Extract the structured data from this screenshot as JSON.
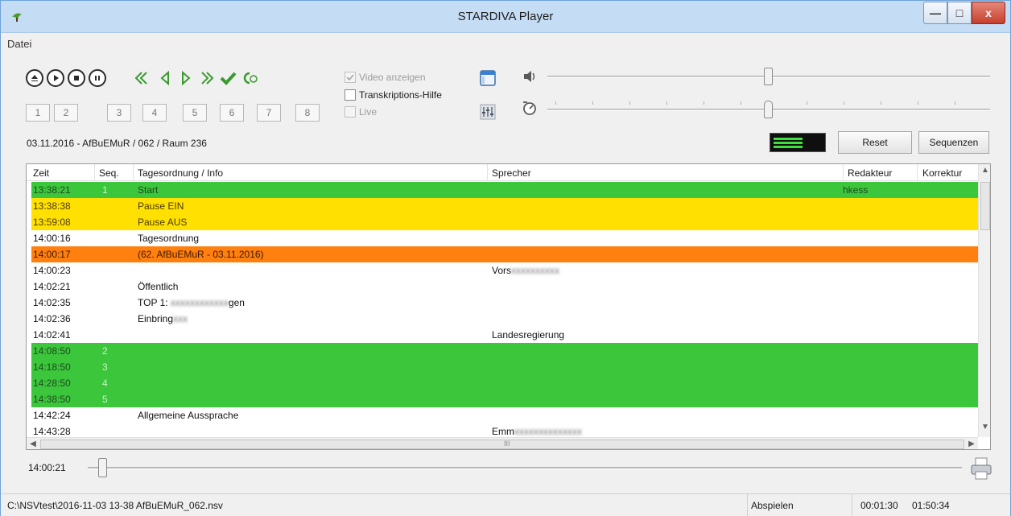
{
  "window": {
    "title": "STARDIVA Player",
    "minimize": "—",
    "maximize": "□",
    "close": "x"
  },
  "menu": {
    "file": "Datei"
  },
  "transport": {
    "eject_icon": "eject-icon",
    "play_icon": "play-icon",
    "stop_icon": "stop-icon",
    "pause_icon": "pause-icon",
    "green_icons": [
      "skip-back-icon",
      "step-back-icon",
      "step-forward-icon",
      "skip-forward-icon",
      "check-icon",
      "loop-icon"
    ]
  },
  "sequence_buttons": [
    "1",
    "2",
    "3",
    "4",
    "5",
    "6",
    "7",
    "8"
  ],
  "options": {
    "video": {
      "label": "Video anzeigen",
      "checked": true,
      "disabled": true
    },
    "transcription": {
      "label": "Transkriptions-Hilfe",
      "checked": false,
      "disabled": false
    },
    "live": {
      "label": "Live",
      "checked": false,
      "disabled": true
    }
  },
  "session": {
    "label": "03.11.2016 - AfBuEMuR / 062 / Raum 236"
  },
  "buttons": {
    "reset": "Reset",
    "sequences": "Sequenzen"
  },
  "table": {
    "columns": [
      "Zeit",
      "Seq.",
      "Tagesordnung / Info",
      "Sprecher",
      "Redakteur",
      "Korrektur"
    ],
    "rows": [
      {
        "time": "13:38:21",
        "seq": "1",
        "info": "Start",
        "speaker": "",
        "editor": "hkess",
        "color": "green"
      },
      {
        "time": "13:38:38",
        "seq": "",
        "info": "Pause EIN",
        "speaker": "",
        "editor": "",
        "color": "yellow"
      },
      {
        "time": "13:59:08",
        "seq": "",
        "info": "Pause AUS",
        "speaker": "",
        "editor": "",
        "color": "yellow"
      },
      {
        "time": "14:00:16",
        "seq": "",
        "info": "Tagesordnung",
        "speaker": "",
        "editor": "",
        "color": "white"
      },
      {
        "time": "14:00:17",
        "seq": "",
        "info": "(62. AfBuEMuR - 03.11.2016)",
        "speaker": "",
        "editor": "",
        "color": "orange"
      },
      {
        "time": "14:00:23",
        "seq": "",
        "info": "",
        "speaker": "Vors",
        "editor": "",
        "color": "white"
      },
      {
        "time": "14:02:21",
        "seq": "",
        "info": "Öffentlich",
        "speaker": "",
        "editor": "",
        "color": "white"
      },
      {
        "time": "14:02:35",
        "seq": "",
        "info": "TOP 1: ",
        "speaker": "",
        "editor": "",
        "color": "white"
      },
      {
        "time": "14:02:36",
        "seq": "",
        "info": "Einbring",
        "speaker": "",
        "editor": "",
        "color": "white"
      },
      {
        "time": "14:02:41",
        "seq": "",
        "info": "",
        "speaker": "Landesregierung",
        "editor": "",
        "color": "white"
      },
      {
        "time": "14:08:50",
        "seq": "2",
        "info": "",
        "speaker": "",
        "editor": "",
        "color": "green"
      },
      {
        "time": "14:18:50",
        "seq": "3",
        "info": "",
        "speaker": "",
        "editor": "",
        "color": "green"
      },
      {
        "time": "14:28:50",
        "seq": "4",
        "info": "",
        "speaker": "",
        "editor": "",
        "color": "green"
      },
      {
        "time": "14:38:50",
        "seq": "5",
        "info": "",
        "speaker": "",
        "editor": "",
        "color": "green"
      },
      {
        "time": "14:42:24",
        "seq": "",
        "info": "Allgemeine Aussprache",
        "speaker": "",
        "editor": "",
        "color": "white"
      },
      {
        "time": "14:43:28",
        "seq": "",
        "info": "",
        "speaker": "Emm",
        "editor": "",
        "color": "white"
      }
    ],
    "hscroll_grip": "III"
  },
  "playback": {
    "position": "14:00:21"
  },
  "status": {
    "file": "C:\\NSVtest\\2016-11-03 13-38 AfBuEMuR_062.nsv",
    "mode": "Abspielen",
    "elapsed": "00:01:30",
    "total": "01:50:34"
  },
  "colors": {
    "green": "#3cc63c",
    "yellow": "#ffe000",
    "orange": "#ff7f0f",
    "accent": "#3a9a2e"
  }
}
